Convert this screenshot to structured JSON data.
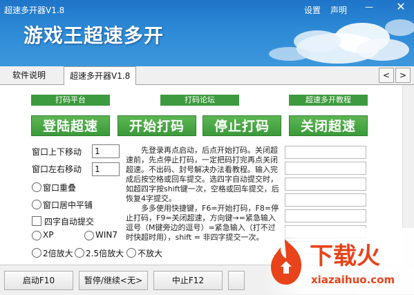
{
  "window": {
    "title": "超速多开器V1.8",
    "settings": "设置",
    "about": "声明",
    "minimize": "—",
    "close": "✕"
  },
  "banner": {
    "title": "游戏王超速多开"
  },
  "tabs": {
    "items": [
      "软件说明",
      "超速多开器V1.8"
    ],
    "prev": "<",
    "next": ">"
  },
  "links": {
    "platform": "打码平台",
    "forum": "打码论坛",
    "tutorial": "超速多开教程"
  },
  "actions": {
    "login": "登陆超速",
    "start": "开始打码",
    "stop": "停止打码",
    "close": "关闭超速"
  },
  "settings": {
    "vertical_label": "窗口上下移动",
    "vertical_value": "1",
    "horizontal_label": "窗口左右移动",
    "horizontal_value": "1",
    "overlap": "窗口重叠",
    "tile": "窗口居中平铺",
    "auto_submit": "四字自动提交",
    "os": [
      "XP",
      "WIN7"
    ],
    "zoom": [
      "2倍放大",
      "2.5倍放大",
      "不放大"
    ]
  },
  "instructions": {
    "p1": "先登录再点启动，后点开始打码。关闭超速前，先点停止打码，一定把码打完再点关闭超速。不出码、封号解决办法看教程。输入完成后按空格或回车提交。选四字自动提交时，如超四字按shift键一次，空格或回车提交，后恢复4字提交。",
    "p2": "多多使用快捷键，F6=开始打码，F8=停止打码，F9=关闭超速，方向键→=紧急输入逗号（M键旁边的逗号）=紧急输入（打不过时快超时用），shift = 非四字提交一次。"
  },
  "bottom": {
    "launch": "启动F10",
    "pause": "暂停/继续<无>",
    "halt": "中止F12"
  },
  "watermark": {
    "brand": "下载火",
    "url": "xiazaihuo.com"
  },
  "colors": {
    "header_blue": "#2d8ad6",
    "button_green": "#3d9a3e",
    "watermark_red": "#e8431a"
  }
}
